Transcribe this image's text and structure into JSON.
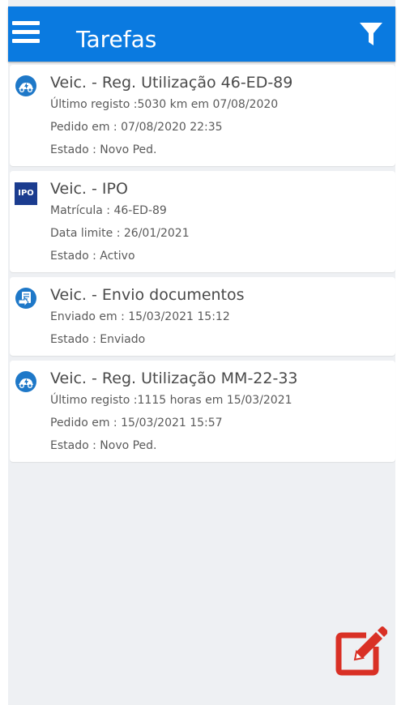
{
  "header": {
    "title": "Tarefas",
    "color": "#0a7ae0"
  },
  "tasks": [
    {
      "icon": "vehicle-usage-icon",
      "title": "Veic. - Reg. Utilização 46-ED-89",
      "lines": [
        "Último registo :5030 km em 07/08/2020",
        "Pedido em :  07/08/2020 22:35",
        "Estado :  Novo Ped."
      ]
    },
    {
      "icon": "ipo-icon",
      "icon_text": "IPO",
      "title": "Veic. - IPO",
      "lines": [
        "Matrícula :  46-ED-89",
        "Data limite :  26/01/2021",
        "Estado :  Activo"
      ]
    },
    {
      "icon": "document-send-icon",
      "title": "Veic. - Envio documentos",
      "lines": [
        "Enviado em :  15/03/2021 15:12",
        "Estado :  Enviado"
      ]
    },
    {
      "icon": "vehicle-usage-icon",
      "title": "Veic. - Reg. Utilização MM-22-33",
      "lines": [
        "Último registo :1115 horas em 15/03/2021",
        "Pedido em :  15/03/2021 15:57",
        "Estado :  Novo Ped."
      ]
    }
  ],
  "fab": {
    "icon": "edit-icon",
    "color": "#d93025"
  }
}
